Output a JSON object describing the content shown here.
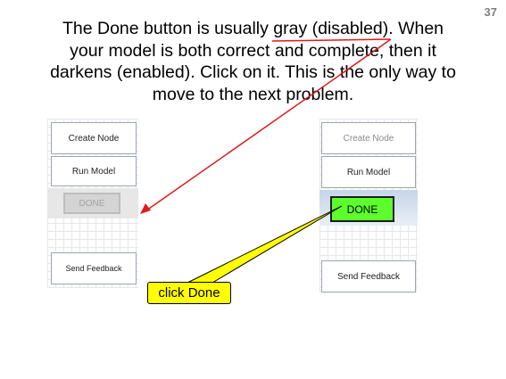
{
  "slide": {
    "number": "37"
  },
  "text": {
    "lines": [
      "The Done button is usually gray (disabled).  When",
      "your model is both correct and complete, then it",
      "darkens (enabled).  Click on it.  This is the only way to",
      "move to the next problem."
    ]
  },
  "left_panel": {
    "create_node": "Create Node",
    "run_model": "Run Model",
    "done": "DONE",
    "send_feedback": "Send Feedback"
  },
  "right_panel": {
    "create_node": "Create Node",
    "run_model": "Run Model",
    "done": "DONE",
    "send_feedback": "Send Feedback"
  },
  "callout": {
    "label": "click Done"
  },
  "colors": {
    "arrow": "#e0191c",
    "callout_fill": "#ffff00",
    "done_enabled": "#5cff2c",
    "done_disabled": "#d4d4d4"
  }
}
